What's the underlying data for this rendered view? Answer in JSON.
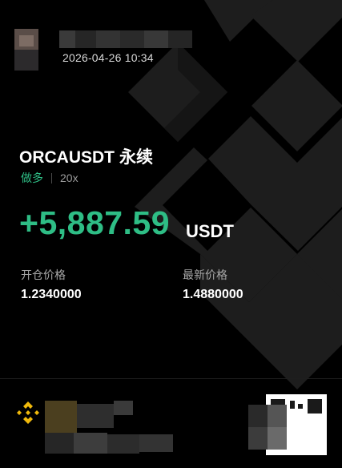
{
  "header": {
    "timestamp": "2026-04-26 10:34"
  },
  "position": {
    "symbol": "ORCAUSDT",
    "contract_type": "永续",
    "side": "做多",
    "leverage": "20x",
    "pnl": "+5,887.59",
    "pnl_unit": "USDT"
  },
  "prices": {
    "open_label": "开仓价格",
    "open_value": "1.2340000",
    "last_label": "最新价格",
    "last_value": "1.4880000"
  },
  "colors": {
    "profit": "#2ebd85",
    "brand": "#f0b90b",
    "background": "#000000"
  },
  "icons": {
    "brand_logo": "binance-logo-icon",
    "qr": "qr-code-icon"
  }
}
